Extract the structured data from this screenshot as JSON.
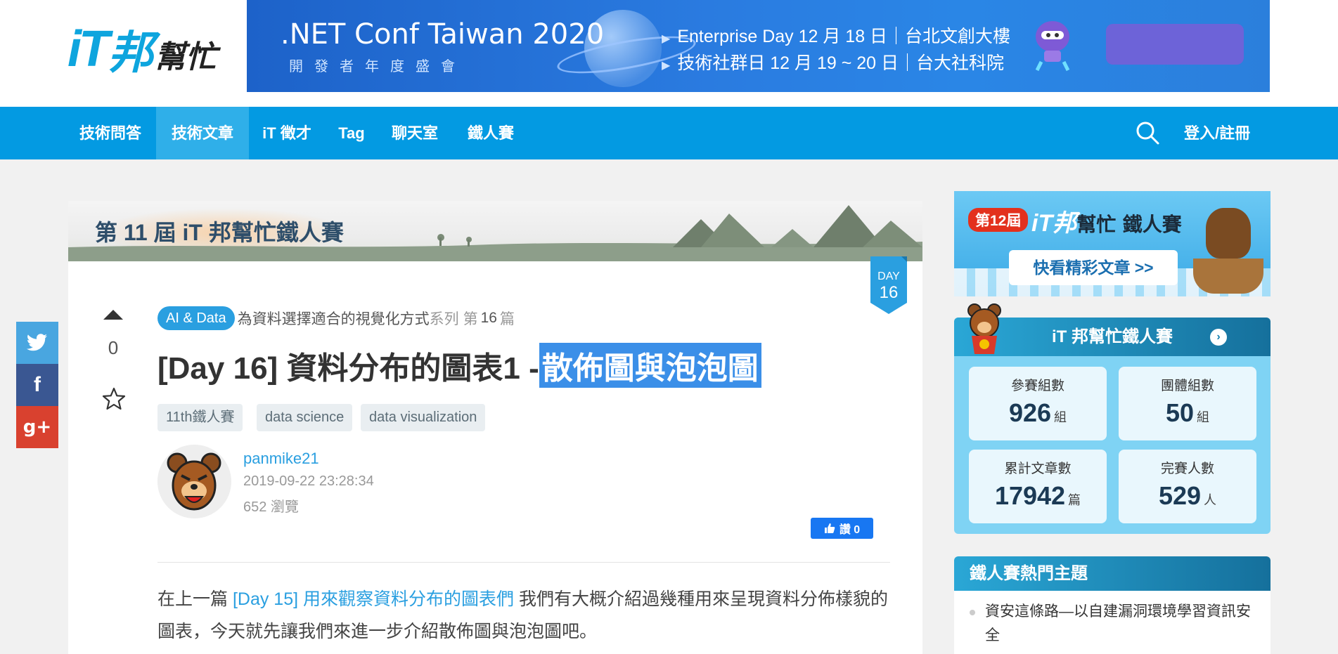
{
  "logo": {
    "it": "iT",
    "bang": "邦",
    "bm": "幫忙"
  },
  "banner": {
    "title": ".NET Conf Taiwan 2020",
    "subtitle": "開發者年度盛會",
    "line1": "Enterprise Day 12 月 18 日｜台北文創大樓",
    "line2": "技術社群日 12 月 19 ~ 20 日｜台大社科院"
  },
  "nav": {
    "items": [
      {
        "label": "技術問答"
      },
      {
        "label": "技術文章"
      },
      {
        "label": "iT 徵才"
      },
      {
        "label": "Tag"
      },
      {
        "label": "聊天室"
      },
      {
        "label": "鐵人賽"
      }
    ],
    "login": "登入/註冊"
  },
  "social": {
    "twitter": "🐦",
    "facebook": "f",
    "gplus": "g+"
  },
  "iron_banner": {
    "title": "第 11 屆 iT 邦幫忙鐵人賽"
  },
  "day_badge": {
    "label": "DAY",
    "num": "16"
  },
  "vote": {
    "count": "0"
  },
  "article": {
    "series_tag": "AI & Data",
    "series_name": "為資料選擇適合的視覺化方式",
    "series_word": "系列",
    "series_prefix": "第",
    "series_num": "16",
    "series_suffix": "篇",
    "title_main": "[Day 16] 資料分布的圖表1 - ",
    "title_highlight": "散佈圖與泡泡圖",
    "tags": [
      "11th鐵人賽",
      "data science",
      "data visualization"
    ],
    "author": "panmike21",
    "date": "2019-09-22 23:28:34",
    "views": "652 瀏覽",
    "like_label": "讚 0",
    "body_prefix": "在上一篇 ",
    "body_link": "[Day 15] 用來觀察資料分布的圖表們",
    "body_suffix": " 我們有大概介紹過幾種用來呈現資料分佈樣貌的圖表，今天就先讓我們來進一步介紹散佈圖與泡泡圖吧。"
  },
  "side_ad": {
    "badge": "第12屆",
    "brand": "iT邦",
    "brand2": "幫忙",
    "brand3": "鐵人賽",
    "cta": "快看精彩文章 >>"
  },
  "stats": {
    "title": "iT 邦幫忙鐵人賽",
    "arrow": "›",
    "items": [
      {
        "label": "參賽組數",
        "value": "926",
        "unit": "組"
      },
      {
        "label": "團體組數",
        "value": "50",
        "unit": "組"
      },
      {
        "label": "累計文章數",
        "value": "17942",
        "unit": "篇"
      },
      {
        "label": "完賽人數",
        "value": "529",
        "unit": "人"
      }
    ]
  },
  "hot": {
    "title": "鐵人賽熱門主題",
    "items": [
      "資安這條路—以自建漏洞環境學習資訊安全"
    ]
  }
}
